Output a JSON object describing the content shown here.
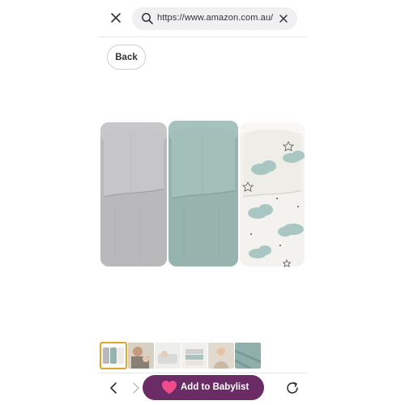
{
  "browser": {
    "url": "https://www.amazon.com.au/",
    "close_icon": "close-icon",
    "search_icon": "search-icon",
    "clear_icon": "clear-icon"
  },
  "page": {
    "back_label": "Back",
    "product_image": "muslin-blankets-three-rolls",
    "thumbnails": [
      {
        "name": "thumbnail-blanket-rolls",
        "selected": true
      },
      {
        "name": "thumbnail-parent-baby",
        "selected": false
      },
      {
        "name": "thumbnail-baby-sleeping",
        "selected": false
      },
      {
        "name": "thumbnail-folded-blankets",
        "selected": false
      },
      {
        "name": "thumbnail-baby-wrapped",
        "selected": false
      },
      {
        "name": "thumbnail-teal-blanket",
        "selected": false
      }
    ]
  },
  "bottom_bar": {
    "add_label": "Add to Babylist",
    "accent_color": "#6b2b64",
    "heart_color": "#f04c8c",
    "prev_icon": "chevron-left-icon",
    "next_icon": "chevron-right-icon",
    "reload_icon": "reload-icon"
  }
}
